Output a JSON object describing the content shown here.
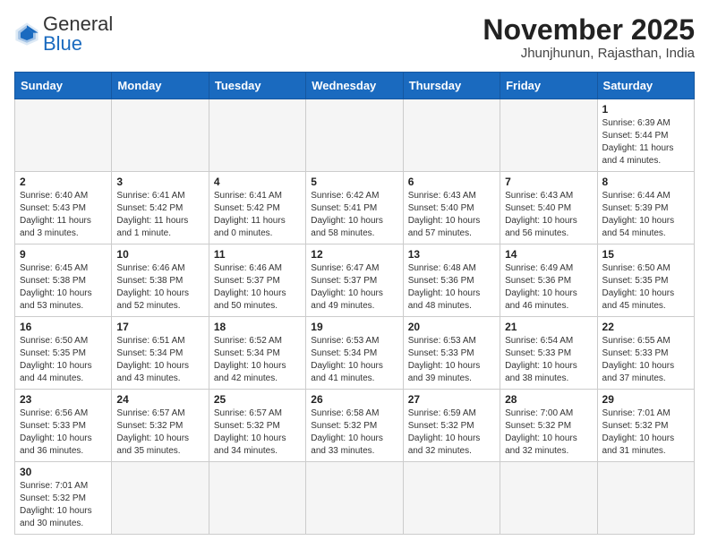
{
  "logo": {
    "text_general": "General",
    "text_blue": "Blue"
  },
  "title": "November 2025",
  "subtitle": "Jhunjhunun, Rajasthan, India",
  "weekdays": [
    "Sunday",
    "Monday",
    "Tuesday",
    "Wednesday",
    "Thursday",
    "Friday",
    "Saturday"
  ],
  "weeks": [
    [
      {
        "day": "",
        "info": ""
      },
      {
        "day": "",
        "info": ""
      },
      {
        "day": "",
        "info": ""
      },
      {
        "day": "",
        "info": ""
      },
      {
        "day": "",
        "info": ""
      },
      {
        "day": "",
        "info": ""
      },
      {
        "day": "1",
        "info": "Sunrise: 6:39 AM\nSunset: 5:44 PM\nDaylight: 11 hours\nand 4 minutes."
      }
    ],
    [
      {
        "day": "2",
        "info": "Sunrise: 6:40 AM\nSunset: 5:43 PM\nDaylight: 11 hours\nand 3 minutes."
      },
      {
        "day": "3",
        "info": "Sunrise: 6:41 AM\nSunset: 5:42 PM\nDaylight: 11 hours\nand 1 minute."
      },
      {
        "day": "4",
        "info": "Sunrise: 6:41 AM\nSunset: 5:42 PM\nDaylight: 11 hours\nand 0 minutes."
      },
      {
        "day": "5",
        "info": "Sunrise: 6:42 AM\nSunset: 5:41 PM\nDaylight: 10 hours\nand 58 minutes."
      },
      {
        "day": "6",
        "info": "Sunrise: 6:43 AM\nSunset: 5:40 PM\nDaylight: 10 hours\nand 57 minutes."
      },
      {
        "day": "7",
        "info": "Sunrise: 6:43 AM\nSunset: 5:40 PM\nDaylight: 10 hours\nand 56 minutes."
      },
      {
        "day": "8",
        "info": "Sunrise: 6:44 AM\nSunset: 5:39 PM\nDaylight: 10 hours\nand 54 minutes."
      }
    ],
    [
      {
        "day": "9",
        "info": "Sunrise: 6:45 AM\nSunset: 5:38 PM\nDaylight: 10 hours\nand 53 minutes."
      },
      {
        "day": "10",
        "info": "Sunrise: 6:46 AM\nSunset: 5:38 PM\nDaylight: 10 hours\nand 52 minutes."
      },
      {
        "day": "11",
        "info": "Sunrise: 6:46 AM\nSunset: 5:37 PM\nDaylight: 10 hours\nand 50 minutes."
      },
      {
        "day": "12",
        "info": "Sunrise: 6:47 AM\nSunset: 5:37 PM\nDaylight: 10 hours\nand 49 minutes."
      },
      {
        "day": "13",
        "info": "Sunrise: 6:48 AM\nSunset: 5:36 PM\nDaylight: 10 hours\nand 48 minutes."
      },
      {
        "day": "14",
        "info": "Sunrise: 6:49 AM\nSunset: 5:36 PM\nDaylight: 10 hours\nand 46 minutes."
      },
      {
        "day": "15",
        "info": "Sunrise: 6:50 AM\nSunset: 5:35 PM\nDaylight: 10 hours\nand 45 minutes."
      }
    ],
    [
      {
        "day": "16",
        "info": "Sunrise: 6:50 AM\nSunset: 5:35 PM\nDaylight: 10 hours\nand 44 minutes."
      },
      {
        "day": "17",
        "info": "Sunrise: 6:51 AM\nSunset: 5:34 PM\nDaylight: 10 hours\nand 43 minutes."
      },
      {
        "day": "18",
        "info": "Sunrise: 6:52 AM\nSunset: 5:34 PM\nDaylight: 10 hours\nand 42 minutes."
      },
      {
        "day": "19",
        "info": "Sunrise: 6:53 AM\nSunset: 5:34 PM\nDaylight: 10 hours\nand 41 minutes."
      },
      {
        "day": "20",
        "info": "Sunrise: 6:53 AM\nSunset: 5:33 PM\nDaylight: 10 hours\nand 39 minutes."
      },
      {
        "day": "21",
        "info": "Sunrise: 6:54 AM\nSunset: 5:33 PM\nDaylight: 10 hours\nand 38 minutes."
      },
      {
        "day": "22",
        "info": "Sunrise: 6:55 AM\nSunset: 5:33 PM\nDaylight: 10 hours\nand 37 minutes."
      }
    ],
    [
      {
        "day": "23",
        "info": "Sunrise: 6:56 AM\nSunset: 5:33 PM\nDaylight: 10 hours\nand 36 minutes."
      },
      {
        "day": "24",
        "info": "Sunrise: 6:57 AM\nSunset: 5:32 PM\nDaylight: 10 hours\nand 35 minutes."
      },
      {
        "day": "25",
        "info": "Sunrise: 6:57 AM\nSunset: 5:32 PM\nDaylight: 10 hours\nand 34 minutes."
      },
      {
        "day": "26",
        "info": "Sunrise: 6:58 AM\nSunset: 5:32 PM\nDaylight: 10 hours\nand 33 minutes."
      },
      {
        "day": "27",
        "info": "Sunrise: 6:59 AM\nSunset: 5:32 PM\nDaylight: 10 hours\nand 32 minutes."
      },
      {
        "day": "28",
        "info": "Sunrise: 7:00 AM\nSunset: 5:32 PM\nDaylight: 10 hours\nand 32 minutes."
      },
      {
        "day": "29",
        "info": "Sunrise: 7:01 AM\nSunset: 5:32 PM\nDaylight: 10 hours\nand 31 minutes."
      }
    ],
    [
      {
        "day": "30",
        "info": "Sunrise: 7:01 AM\nSunset: 5:32 PM\nDaylight: 10 hours\nand 30 minutes."
      },
      {
        "day": "",
        "info": ""
      },
      {
        "day": "",
        "info": ""
      },
      {
        "day": "",
        "info": ""
      },
      {
        "day": "",
        "info": ""
      },
      {
        "day": "",
        "info": ""
      },
      {
        "day": "",
        "info": ""
      }
    ]
  ]
}
